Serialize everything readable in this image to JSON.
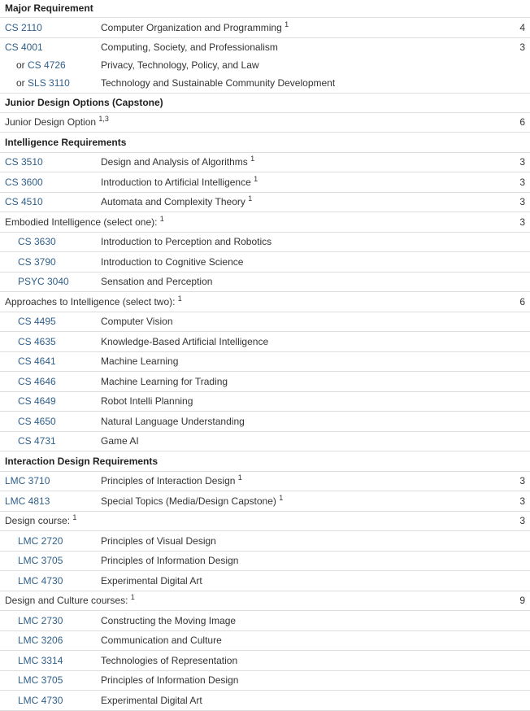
{
  "rows": [
    {
      "type": "heading",
      "text": "Major Requirement",
      "h": 21
    },
    {
      "type": "course",
      "code": "CS 2110",
      "title": "Computer Organization and Programming",
      "sup": "1",
      "hours": "4",
      "h": 25
    },
    {
      "type": "course",
      "code": "CS 4001",
      "title": "Computing, Society, and Professionalism",
      "sup": "",
      "hours": "3",
      "h": 23,
      "cont": "cont"
    },
    {
      "type": "course",
      "prefix": "or ",
      "code": "CS 4726",
      "title": "Privacy, Technology, Policy, and Law",
      "sup": "",
      "hours": "",
      "h": 21,
      "indent": 14,
      "cont": "cont"
    },
    {
      "type": "course",
      "prefix": "or ",
      "code": "SLS 3110",
      "title": "Technology and Sustainable Community Development",
      "sup": "",
      "hours": "",
      "h": 24,
      "indent": 14,
      "cont": "cont-last"
    },
    {
      "type": "heading",
      "text": "Junior Design Options (Capstone)",
      "h": 24
    },
    {
      "type": "label",
      "text": "Junior Design Option",
      "sup": "1,3",
      "hours": "6",
      "h": 24
    },
    {
      "type": "heading",
      "text": "Intelligence Requirements",
      "h": 25
    },
    {
      "type": "course",
      "code": "CS 3510",
      "title": "Design and Analysis of Algorithms",
      "sup": "1",
      "hours": "3",
      "h": 24
    },
    {
      "type": "course",
      "code": "CS 3600",
      "title": "Introduction to Artificial Intelligence",
      "sup": "1",
      "hours": "3",
      "h": 25
    },
    {
      "type": "course",
      "code": "CS 4510",
      "title": "Automata and Complexity Theory",
      "sup": "1",
      "hours": "3",
      "h": 24
    },
    {
      "type": "label",
      "text": "Embodied Intelligence (select one):",
      "sup": "1",
      "hours": "3",
      "h": 25
    },
    {
      "type": "course",
      "code": "CS 3630",
      "title": "Introduction to Perception and Robotics",
      "sup": "",
      "hours": "",
      "h": 24,
      "indent": 16
    },
    {
      "type": "course",
      "code": "CS 3790",
      "title": "Introduction to Cognitive Science",
      "sup": "",
      "hours": "",
      "h": 25,
      "indent": 16
    },
    {
      "type": "course",
      "code": "PSYC 3040",
      "title": "Sensation and Perception",
      "sup": "",
      "hours": "",
      "h": 24,
      "indent": 16
    },
    {
      "type": "label",
      "text": "Approaches to Intelligence (select two):",
      "sup": "1",
      "hours": "6",
      "h": 25
    },
    {
      "type": "course",
      "code": "CS 4495",
      "title": "Computer Vision",
      "sup": "",
      "hours": "",
      "h": 24,
      "indent": 16
    },
    {
      "type": "course",
      "code": "CS 4635",
      "title": "Knowledge-Based Artificial Intelligence",
      "sup": "",
      "hours": "",
      "h": 25,
      "indent": 16
    },
    {
      "type": "course",
      "code": "CS 4641",
      "title": "Machine Learning",
      "sup": "",
      "hours": "",
      "h": 24,
      "indent": 16
    },
    {
      "type": "course",
      "code": "CS 4646",
      "title": "Machine Learning for Trading",
      "sup": "",
      "hours": "",
      "h": 25,
      "indent": 16
    },
    {
      "type": "course",
      "code": "CS 4649",
      "title": "Robot Intelli Planning",
      "sup": "",
      "hours": "",
      "h": 24,
      "indent": 16
    },
    {
      "type": "course",
      "code": "CS 4650",
      "title": "Natural Language Understanding",
      "sup": "",
      "hours": "",
      "h": 25,
      "indent": 16
    },
    {
      "type": "course",
      "code": "CS 4731",
      "title": "Game AI",
      "sup": "",
      "hours": "",
      "h": 24,
      "indent": 16
    },
    {
      "type": "heading",
      "text": "Interaction Design Requirements",
      "h": 25
    },
    {
      "type": "course",
      "code": "LMC 3710",
      "title": "Principles of Interaction Design",
      "sup": "1",
      "hours": "3",
      "h": 24
    },
    {
      "type": "course",
      "code": "LMC 4813",
      "title": "Special Topics (Media/Design Capstone)",
      "sup": "1",
      "hours": "3",
      "h": 25
    },
    {
      "type": "label",
      "text": "Design course:",
      "sup": "1",
      "hours": "3",
      "h": 24
    },
    {
      "type": "course",
      "code": "LMC 2720",
      "title": "Principles of Visual Design",
      "sup": "",
      "hours": "",
      "h": 25,
      "indent": 16
    },
    {
      "type": "course",
      "code": "LMC 3705",
      "title": "Principles of Information Design",
      "sup": "",
      "hours": "",
      "h": 24,
      "indent": 16
    },
    {
      "type": "course",
      "code": "LMC 4730",
      "title": "Experimental Digital Art",
      "sup": "",
      "hours": "",
      "h": 25,
      "indent": 16
    },
    {
      "type": "label",
      "text": "Design and Culture courses:",
      "sup": "1",
      "hours": "9",
      "h": 24
    },
    {
      "type": "course",
      "code": "LMC 2730",
      "title": "Constructing the Moving Image",
      "sup": "",
      "hours": "",
      "h": 25,
      "indent": 16
    },
    {
      "type": "course",
      "code": "LMC 3206",
      "title": "Communication and Culture",
      "sup": "",
      "hours": "",
      "h": 24,
      "indent": 16
    },
    {
      "type": "course",
      "code": "LMC 3314",
      "title": "Technologies of Representation",
      "sup": "",
      "hours": "",
      "h": 25,
      "indent": 16
    },
    {
      "type": "course",
      "code": "LMC 3705",
      "title": "Principles of Information Design",
      "sup": "",
      "hours": "",
      "h": 24,
      "indent": 16
    },
    {
      "type": "course",
      "code": "LMC 4730",
      "title": "Experimental Digital Art",
      "sup": "",
      "hours": "",
      "h": 25,
      "indent": 16
    }
  ]
}
